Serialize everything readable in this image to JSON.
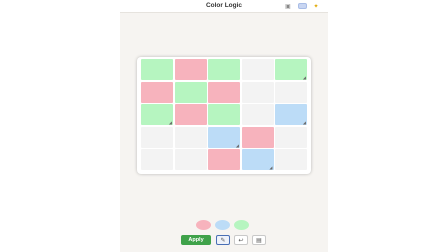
{
  "header": {
    "title": "Color Logic",
    "save_icon": "save-icon",
    "toggle_icon": "toggle-icon",
    "hint_icon": "lightbulb-icon"
  },
  "colors": {
    "green": "#b6f5c0",
    "red": "#f7b3bd",
    "blue": "#bcdcf7",
    "empty": "#f3f3f3",
    "apply": "#3fa24a"
  },
  "grid": {
    "rows": 5,
    "cols": 5,
    "cells": [
      [
        "green",
        "red",
        "green",
        "empty",
        "green"
      ],
      [
        "red",
        "green",
        "red",
        "empty",
        "empty"
      ],
      [
        "green",
        "red",
        "green",
        "empty",
        "blue"
      ],
      [
        "empty",
        "empty",
        "blue",
        "red",
        "empty"
      ],
      [
        "empty",
        "empty",
        "red",
        "blue",
        "empty"
      ]
    ],
    "marked": [
      [
        0,
        4
      ],
      [
        2,
        0
      ],
      [
        2,
        4
      ],
      [
        3,
        2
      ],
      [
        4,
        3
      ]
    ]
  },
  "palette": [
    "red",
    "blue",
    "green"
  ],
  "controls": {
    "apply_label": "Apply",
    "pencil_icon": "pencil-icon",
    "undo_icon": "undo-icon",
    "image_icon": "image-icon"
  }
}
